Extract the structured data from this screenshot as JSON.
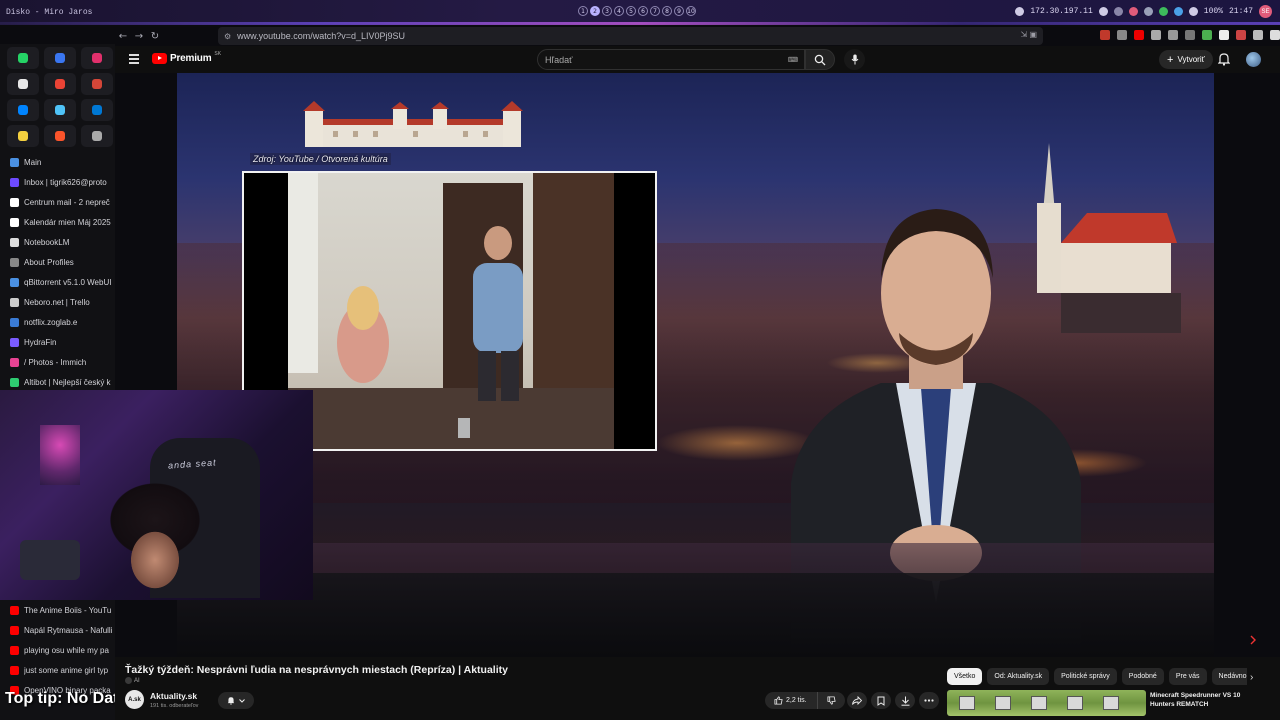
{
  "desktop": {
    "window_title": "Disko - Miro Jaros",
    "workspaces": [
      "1",
      "2",
      "3",
      "4",
      "5",
      "6",
      "7",
      "8",
      "9",
      "10"
    ],
    "active_workspace": "2",
    "ip": "172.30.197.11",
    "battery": "100%",
    "time": "21:47",
    "user_initials": "SE"
  },
  "browser": {
    "url": "www.youtube.com/watch?v=d_LIV0Pj9SU",
    "back_glyph": "←",
    "forward_glyph": "→",
    "reload_glyph": "↻"
  },
  "sidebar": {
    "pinned_icons": [
      "whatsapp-icon",
      "signal-icon",
      "instagram-icon",
      "x-icon",
      "gmail-icon",
      "gmail-alt-icon",
      "messenger-icon",
      "droplet-icon",
      "outlook-icon",
      "notes-icon",
      "brave-icon",
      "settings-icon"
    ],
    "pinned_colors": [
      "#25d366",
      "#3a76f0",
      "#e1306c",
      "#e8e8e8",
      "#ea4335",
      "#d44638",
      "#0084ff",
      "#4fc3f7",
      "#0078d4",
      "#f4d03f",
      "#fb542b",
      "#aaaaaa"
    ],
    "tabs": [
      {
        "label": "Main",
        "color": "#4a90e2"
      },
      {
        "label": "Inbox | tigrik626@proto",
        "color": "#6d4aff"
      },
      {
        "label": "Centrum mail - 2 nepreč",
        "color": "#ffffff"
      },
      {
        "label": "Kalendár mien Máj 2025",
        "color": "#ffffff"
      },
      {
        "label": "NotebookLM",
        "color": "#dddddd"
      },
      {
        "label": "About Profiles",
        "color": "#888888"
      },
      {
        "label": "qBittorrent v5.1.0 WebUI",
        "color": "#4a90e2"
      },
      {
        "label": "Nebo​ro.net | Trello",
        "color": "#cccccc"
      },
      {
        "label": "notflix.zoglab.e",
        "color": "#3a7bd5"
      },
      {
        "label": "HydraFin",
        "color": "#7a5cff"
      },
      {
        "label": "/ Photos - Immich",
        "color": "#e84393"
      },
      {
        "label": "Altibot | Nejlepší český k",
        "color": "#2ecc71"
      }
    ],
    "bottom_tabs": [
      {
        "label": "The Anime Boiis - YouTu",
        "color": "#ff0000"
      },
      {
        "label": "Napál Rytmausa - Nafulli",
        "color": "#ff0000"
      },
      {
        "label": "playing osu while my pa",
        "color": "#ff0000"
      },
      {
        "label": "just some anime girl typ",
        "color": "#ff0000"
      },
      {
        "label": "OpenVINO binary packa",
        "color": "#ff0000"
      }
    ],
    "tooltip": "Top tip: No Data"
  },
  "youtube": {
    "logo_label": "Premium",
    "logo_region": "SK",
    "search_placeholder": "Hľadať",
    "create_label": "Vytvoriť",
    "video": {
      "source_caption": "Zdroj: YouTube / Otvorená kultúra",
      "title": "Ťažký týždeň: Nesprávni ľudia na nesprávnych miestach (Repríza) | Aktuality",
      "ai_label": "AI"
    },
    "channel": {
      "name": "Aktuality.sk",
      "subscribers": "191 tis. odberateľov",
      "avatar_text": "A.sk"
    },
    "likes": "2,2 tis.",
    "chips": [
      "Všetko",
      "Od: Aktuality.sk",
      "Politické správy",
      "Podobné",
      "Pre vás",
      "Nedávno nahr"
    ],
    "active_chip": "Všetko",
    "recommendation": {
      "title": "Minecraft Speedrunner VS 10 Hunters REMATCH"
    }
  },
  "webcam": {
    "chair_text": "anda seat"
  }
}
